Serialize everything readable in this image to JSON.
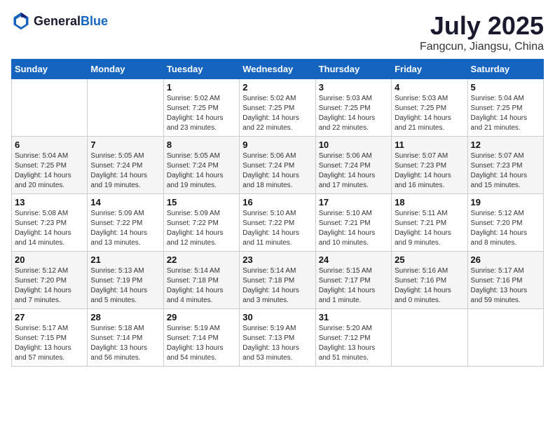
{
  "logo": {
    "general": "General",
    "blue": "Blue"
  },
  "title": "July 2025",
  "location": "Fangcun, Jiangsu, China",
  "weekdays": [
    "Sunday",
    "Monday",
    "Tuesday",
    "Wednesday",
    "Thursday",
    "Friday",
    "Saturday"
  ],
  "weeks": [
    [
      {
        "day": "",
        "detail": ""
      },
      {
        "day": "",
        "detail": ""
      },
      {
        "day": "1",
        "detail": "Sunrise: 5:02 AM\nSunset: 7:25 PM\nDaylight: 14 hours and 23 minutes."
      },
      {
        "day": "2",
        "detail": "Sunrise: 5:02 AM\nSunset: 7:25 PM\nDaylight: 14 hours and 22 minutes."
      },
      {
        "day": "3",
        "detail": "Sunrise: 5:03 AM\nSunset: 7:25 PM\nDaylight: 14 hours and 22 minutes."
      },
      {
        "day": "4",
        "detail": "Sunrise: 5:03 AM\nSunset: 7:25 PM\nDaylight: 14 hours and 21 minutes."
      },
      {
        "day": "5",
        "detail": "Sunrise: 5:04 AM\nSunset: 7:25 PM\nDaylight: 14 hours and 21 minutes."
      }
    ],
    [
      {
        "day": "6",
        "detail": "Sunrise: 5:04 AM\nSunset: 7:25 PM\nDaylight: 14 hours and 20 minutes."
      },
      {
        "day": "7",
        "detail": "Sunrise: 5:05 AM\nSunset: 7:24 PM\nDaylight: 14 hours and 19 minutes."
      },
      {
        "day": "8",
        "detail": "Sunrise: 5:05 AM\nSunset: 7:24 PM\nDaylight: 14 hours and 19 minutes."
      },
      {
        "day": "9",
        "detail": "Sunrise: 5:06 AM\nSunset: 7:24 PM\nDaylight: 14 hours and 18 minutes."
      },
      {
        "day": "10",
        "detail": "Sunrise: 5:06 AM\nSunset: 7:24 PM\nDaylight: 14 hours and 17 minutes."
      },
      {
        "day": "11",
        "detail": "Sunrise: 5:07 AM\nSunset: 7:23 PM\nDaylight: 14 hours and 16 minutes."
      },
      {
        "day": "12",
        "detail": "Sunrise: 5:07 AM\nSunset: 7:23 PM\nDaylight: 14 hours and 15 minutes."
      }
    ],
    [
      {
        "day": "13",
        "detail": "Sunrise: 5:08 AM\nSunset: 7:23 PM\nDaylight: 14 hours and 14 minutes."
      },
      {
        "day": "14",
        "detail": "Sunrise: 5:09 AM\nSunset: 7:22 PM\nDaylight: 14 hours and 13 minutes."
      },
      {
        "day": "15",
        "detail": "Sunrise: 5:09 AM\nSunset: 7:22 PM\nDaylight: 14 hours and 12 minutes."
      },
      {
        "day": "16",
        "detail": "Sunrise: 5:10 AM\nSunset: 7:22 PM\nDaylight: 14 hours and 11 minutes."
      },
      {
        "day": "17",
        "detail": "Sunrise: 5:10 AM\nSunset: 7:21 PM\nDaylight: 14 hours and 10 minutes."
      },
      {
        "day": "18",
        "detail": "Sunrise: 5:11 AM\nSunset: 7:21 PM\nDaylight: 14 hours and 9 minutes."
      },
      {
        "day": "19",
        "detail": "Sunrise: 5:12 AM\nSunset: 7:20 PM\nDaylight: 14 hours and 8 minutes."
      }
    ],
    [
      {
        "day": "20",
        "detail": "Sunrise: 5:12 AM\nSunset: 7:20 PM\nDaylight: 14 hours and 7 minutes."
      },
      {
        "day": "21",
        "detail": "Sunrise: 5:13 AM\nSunset: 7:19 PM\nDaylight: 14 hours and 5 minutes."
      },
      {
        "day": "22",
        "detail": "Sunrise: 5:14 AM\nSunset: 7:18 PM\nDaylight: 14 hours and 4 minutes."
      },
      {
        "day": "23",
        "detail": "Sunrise: 5:14 AM\nSunset: 7:18 PM\nDaylight: 14 hours and 3 minutes."
      },
      {
        "day": "24",
        "detail": "Sunrise: 5:15 AM\nSunset: 7:17 PM\nDaylight: 14 hours and 1 minute."
      },
      {
        "day": "25",
        "detail": "Sunrise: 5:16 AM\nSunset: 7:16 PM\nDaylight: 14 hours and 0 minutes."
      },
      {
        "day": "26",
        "detail": "Sunrise: 5:17 AM\nSunset: 7:16 PM\nDaylight: 13 hours and 59 minutes."
      }
    ],
    [
      {
        "day": "27",
        "detail": "Sunrise: 5:17 AM\nSunset: 7:15 PM\nDaylight: 13 hours and 57 minutes."
      },
      {
        "day": "28",
        "detail": "Sunrise: 5:18 AM\nSunset: 7:14 PM\nDaylight: 13 hours and 56 minutes."
      },
      {
        "day": "29",
        "detail": "Sunrise: 5:19 AM\nSunset: 7:14 PM\nDaylight: 13 hours and 54 minutes."
      },
      {
        "day": "30",
        "detail": "Sunrise: 5:19 AM\nSunset: 7:13 PM\nDaylight: 13 hours and 53 minutes."
      },
      {
        "day": "31",
        "detail": "Sunrise: 5:20 AM\nSunset: 7:12 PM\nDaylight: 13 hours and 51 minutes."
      },
      {
        "day": "",
        "detail": ""
      },
      {
        "day": "",
        "detail": ""
      }
    ]
  ]
}
